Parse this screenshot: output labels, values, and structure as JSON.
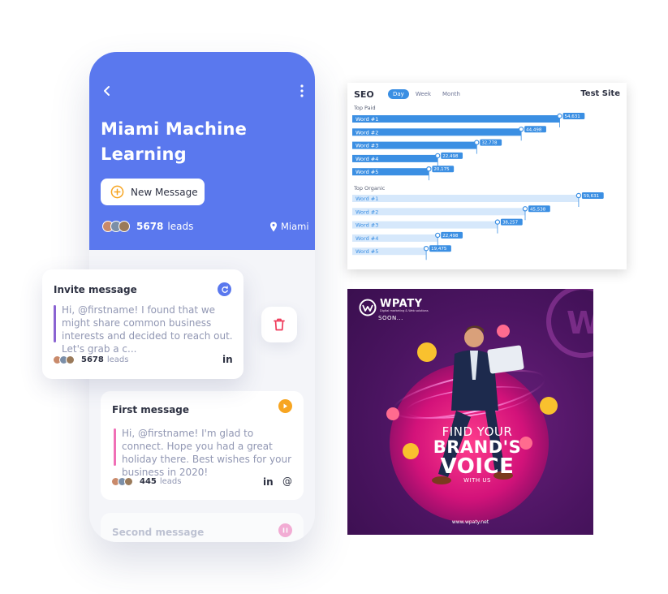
{
  "phone": {
    "title": "Miami Machine Learning",
    "new_message_label": "New Message",
    "leads_count": "5678",
    "leads_label": "leads",
    "location": "Miami"
  },
  "invite_card": {
    "title": "Invite message",
    "body": "Hi, @firstname! I found that we might share common business interests and decided to reach out. Let's grab a c...",
    "leads_count": "5678",
    "leads_label": "leads",
    "network": "in",
    "accent": "#8a63d2",
    "status_color": "#5a78ee"
  },
  "first_card": {
    "title": "First message",
    "body": "Hi, @firstname! I'm glad to connect. Hope you had a great holiday there. Best wishes for your business in 2020!",
    "leads_count": "445",
    "leads_label": "leads",
    "network": "in",
    "email_icon": "@",
    "accent": "#f06fb6",
    "status_color": "#f7a521"
  },
  "second_card": {
    "title": "Second message",
    "status_color": "#f06fb6"
  },
  "seo": {
    "title": "SEO",
    "tabs": [
      "Day",
      "Week",
      "Month"
    ],
    "active_tab": "Day",
    "site": "Test Site",
    "accent": "#3b8fe3"
  },
  "chart_data": [
    {
      "type": "bar",
      "title": "Top Paid",
      "categories": [
        "Word #1",
        "Word #2",
        "Word #3",
        "Word #4",
        "Word #5"
      ],
      "values": [
        54631,
        44498,
        32778,
        22498,
        20175
      ],
      "labels": [
        "54,631",
        "44,498",
        "32,778",
        "22,498",
        "20,175"
      ],
      "xlim": [
        0,
        62000
      ]
    },
    {
      "type": "bar",
      "title": "Top Organic",
      "categories": [
        "Word #1",
        "Word #2",
        "Word #3",
        "Word #4",
        "Word #5"
      ],
      "values": [
        59631,
        45538,
        38257,
        22498,
        19475
      ],
      "labels": [
        "59,631",
        "45,538",
        "38,257",
        "22,498",
        "19,475"
      ],
      "xlim": [
        0,
        62000
      ]
    }
  ],
  "poster": {
    "brand": "WPATY",
    "tagline": "Digital marketing & Web solutions",
    "soon": "SOON...",
    "headline_1": "FIND YOUR",
    "headline_2": "BRAND'S",
    "headline_3": "VOICE",
    "headline_4": "WITH US",
    "url": "www.wpaty.net"
  }
}
